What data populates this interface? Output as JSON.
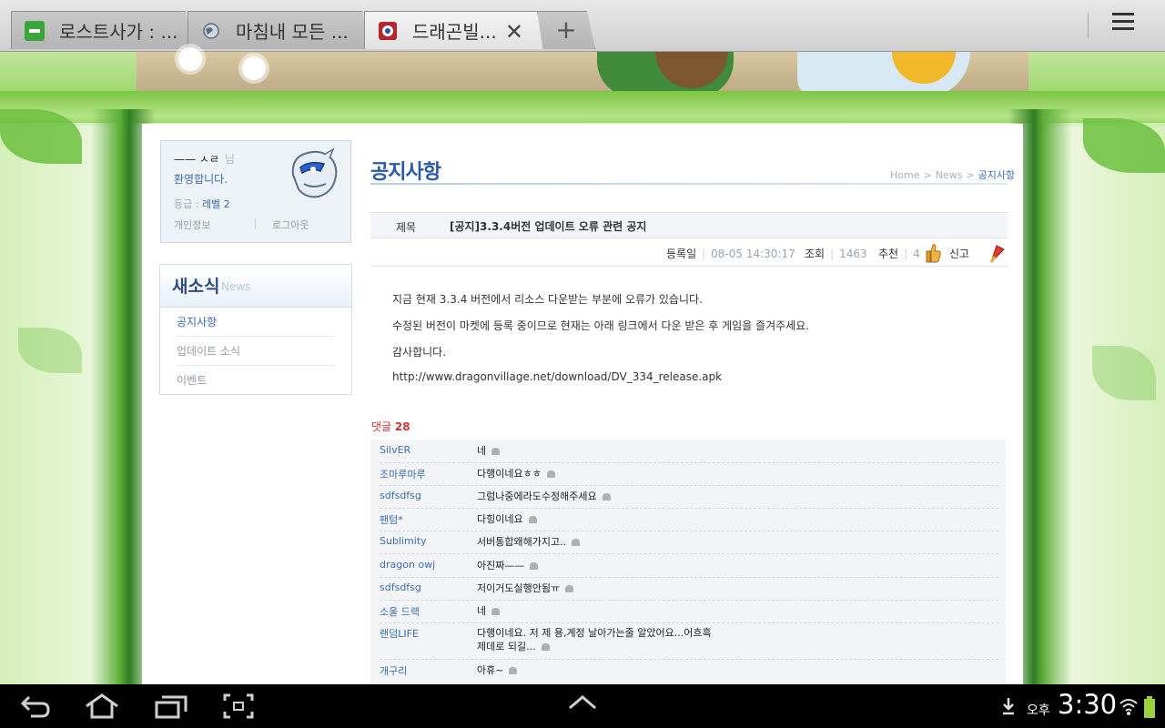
{
  "browser": {
    "tabs": [
      {
        "title": "로스트사가 : ...",
        "active": false
      },
      {
        "title": "마침내 모든 ...",
        "active": false
      },
      {
        "title": "드래곤빌...",
        "active": true
      }
    ],
    "new_tab_label": "+",
    "close_label": "✕"
  },
  "sidebar": {
    "user_name": "—— ㅅㄹ",
    "honorific": "님",
    "welcome": "환영합니다.",
    "grade_label": "등급 :",
    "grade_value": "레벨 2",
    "profile_link": "개인정보",
    "logout_link": "로그아웃",
    "section_title": "새소식",
    "section_sub": "News",
    "items": [
      {
        "label": "공지사항",
        "active": true
      },
      {
        "label": "업데이트 소식",
        "active": false
      },
      {
        "label": "이벤트",
        "active": false
      }
    ]
  },
  "main": {
    "title": "공지사항",
    "breadcrumb": [
      "Home",
      "News",
      "공지사항"
    ],
    "subject_label": "제목",
    "subject": "[공지]3.3.4버전 업데이트 오류 관련 공지",
    "meta": {
      "date_label": "등록일",
      "date": "08-05 14:30:17",
      "views_label": "조회",
      "views": "1463",
      "recommend_label": "추천",
      "recommend": "4",
      "report_label": "신고"
    },
    "body": [
      "지금 현재 3.3.4 버전에서 리소스 다운받는 부분에 오류가 있습니다.",
      "수정된 버전이 마켓에 등록 중이므로 현재는 아래 링크에서 다운 받은 후 게임을 즐겨주세요.",
      "감사합니다.",
      "http://www.dragonvillage.net/download/DV_334_release.apk"
    ],
    "reply_label": "댓글",
    "reply_count": "28",
    "comments": [
      {
        "name": "SilvER",
        "text": "네"
      },
      {
        "name": "조마루마루",
        "text": "다행이네요ㅎㅎ"
      },
      {
        "name": "sdfsdfsg",
        "text": "그럼나중에라도수정해주세요"
      },
      {
        "name": "팬텀*",
        "text": "다힝이네요"
      },
      {
        "name": "Sublimity",
        "text": "서버통합왜해가지고.."
      },
      {
        "name": "dragon owj",
        "text": "아진짜——"
      },
      {
        "name": "sdfsdfsg",
        "text": "저이거도실행안됨ㅠ"
      },
      {
        "name": "소울 드랙",
        "text": "네"
      },
      {
        "name": "랜덤LIFE",
        "text": "다행이네요. 저 제 용,계정 날아가는줄 알았어요...어흐흑",
        "text2": "제데로 되길..."
      },
      {
        "name": "개구리",
        "text": "아휴~"
      }
    ]
  },
  "system": {
    "ampm": "오후",
    "time": "3:30"
  },
  "colors": {
    "link_blue": "#3a6cb2",
    "title_blue": "#2b5aa6",
    "reply_red": "#cc3333",
    "leaf_green": "#6cbf3f"
  }
}
